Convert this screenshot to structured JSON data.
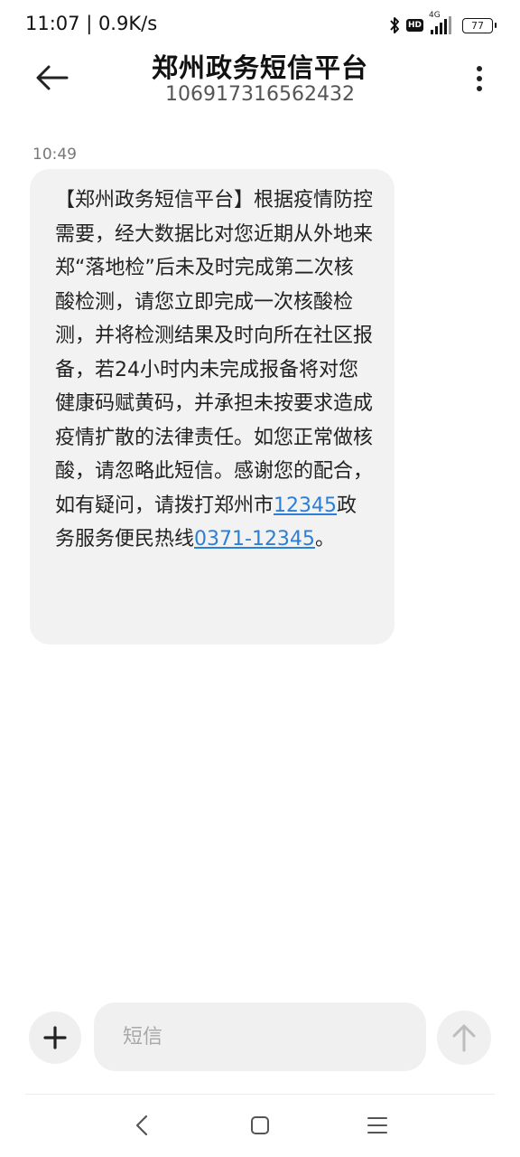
{
  "status_bar": {
    "time_speed": "11:07 | 0.9K/s",
    "network": "4G",
    "hd": "HD",
    "battery": "77"
  },
  "header": {
    "title": "郑州政务短信平台",
    "number": "106917316562432"
  },
  "conversation": {
    "timestamp": "10:49",
    "message": {
      "text_part1": "【郑州政务短信平台】根据疫情防控需要，经大数据比对您近期从外地来郑“落地检”后未及时完成第二次核酸检测，请您立即完成一次核酸检测，并将检测结果及时向所在社区报备，若24小时内未完成报备将对您健康码赋黄码，并承担未按要求造成疫情扩散的法律责任。如您正常做核酸，请忽略此短信。感谢您的配合，如有疑问，请拨打郑州市",
      "link1": "12345",
      "text_part2": "政务服务便民热线",
      "link2": "0371-12345",
      "text_part3": "。"
    }
  },
  "compose": {
    "placeholder": "短信",
    "value": ""
  },
  "icons": {
    "back": "arrow-left-icon",
    "more": "more-vertical-icon",
    "add": "plus-icon",
    "send": "arrow-up-icon",
    "nav_back": "chevron-left-icon",
    "nav_home": "square-icon",
    "nav_recents": "menu-icon"
  },
  "colors": {
    "link": "#2b7fd6",
    "bubble": "#f2f2f2"
  }
}
